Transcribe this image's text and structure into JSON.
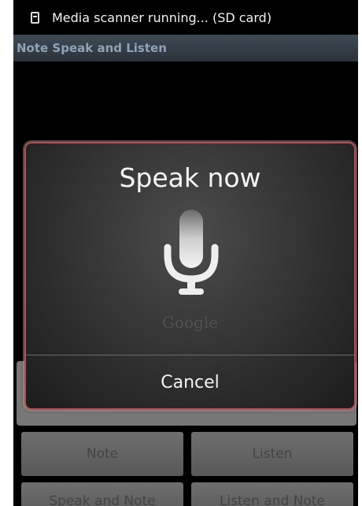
{
  "status_bar": {
    "notification_icon": "sd-card-icon",
    "text": "Media scanner running... (SD card)"
  },
  "app": {
    "title": "Note Speak and Listen",
    "buttons": {
      "note": "Note",
      "listen": "Listen",
      "speak_and_note": "Speak and Note",
      "listen_and_note": "Listen and Note"
    }
  },
  "dialog": {
    "title": "Speak now",
    "icon": "microphone-icon",
    "brand": "Google",
    "cancel_label": "Cancel"
  },
  "colors": {
    "dialog_border": "#b45050",
    "title_bar": "#2b333b"
  }
}
